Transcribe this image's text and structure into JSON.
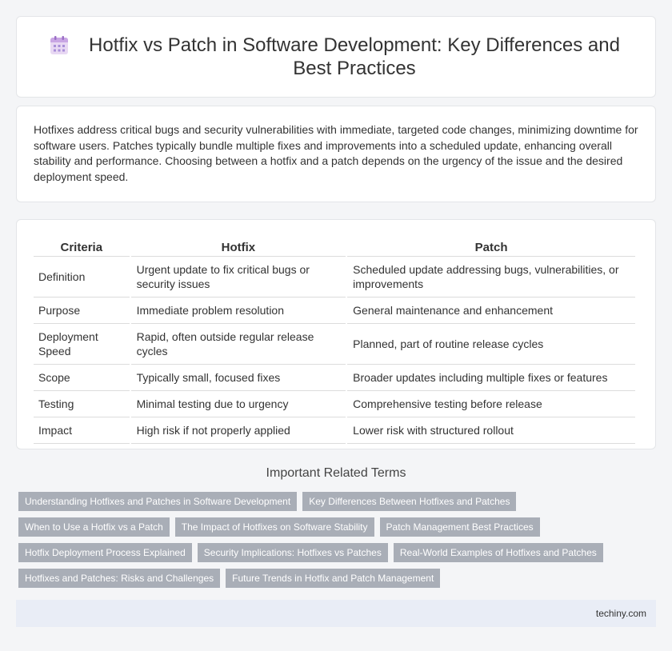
{
  "header": {
    "title": "Hotfix vs Patch in Software Development: Key Differences and Best Practices",
    "icon": "calendar-icon"
  },
  "intro": {
    "text": "Hotfixes address critical bugs and security vulnerabilities with immediate, targeted code changes, minimizing downtime for software users. Patches typically bundle multiple fixes and improvements into a scheduled update, enhancing overall stability and performance. Choosing between a hotfix and a patch depends on the urgency of the issue and the desired deployment speed."
  },
  "table": {
    "headers": [
      "Criteria",
      "Hotfix",
      "Patch"
    ],
    "rows": [
      [
        "Definition",
        "Urgent update to fix critical bugs or security issues",
        "Scheduled update addressing bugs, vulnerabilities, or improvements"
      ],
      [
        "Purpose",
        "Immediate problem resolution",
        "General maintenance and enhancement"
      ],
      [
        "Deployment Speed",
        "Rapid, often outside regular release cycles",
        "Planned, part of routine release cycles"
      ],
      [
        "Scope",
        "Typically small, focused fixes",
        "Broader updates including multiple fixes or features"
      ],
      [
        "Testing",
        "Minimal testing due to urgency",
        "Comprehensive testing before release"
      ],
      [
        "Impact",
        "High risk if not properly applied",
        "Lower risk with structured rollout"
      ]
    ]
  },
  "related": {
    "title": "Important Related Terms",
    "tags": [
      "Understanding Hotfixes and Patches in Software Development",
      "Key Differences Between Hotfixes and Patches",
      "When to Use a Hotfix vs a Patch",
      "The Impact of Hotfixes on Software Stability",
      "Patch Management Best Practices",
      "Hotfix Deployment Process Explained",
      "Security Implications: Hotfixes vs Patches",
      "Real-World Examples of Hotfixes and Patches",
      "Hotfixes and Patches: Risks and Challenges",
      "Future Trends in Hotfix and Patch Management"
    ]
  },
  "footer": {
    "site": "techiny.com"
  }
}
